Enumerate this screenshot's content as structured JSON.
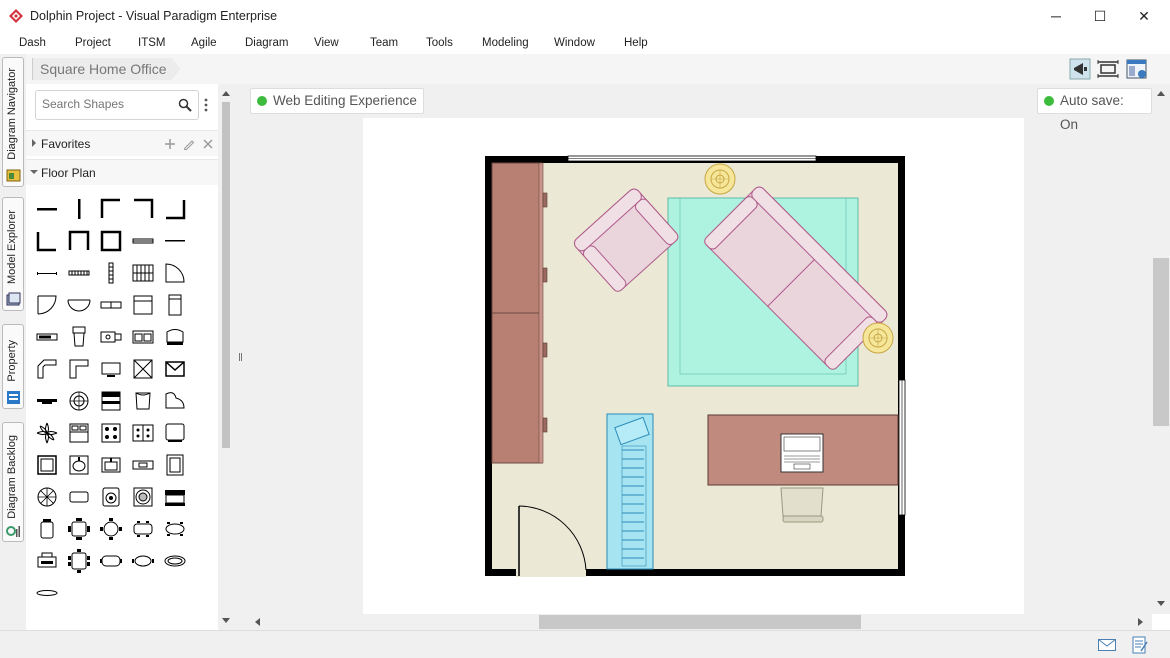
{
  "window": {
    "title": "Dolphin Project - Visual Paradigm Enterprise",
    "minimize": "─",
    "maximize": "☐",
    "close": "✕"
  },
  "menu": [
    "Dash",
    "Project",
    "ITSM",
    "Agile",
    "Diagram",
    "View",
    "Team",
    "Tools",
    "Modeling",
    "Window",
    "Help"
  ],
  "side_tabs": {
    "navigator": "Diagram Navigator",
    "explorer": "Model Explorer",
    "property": "Property",
    "backlog": "Diagram Backlog"
  },
  "breadcrumb": "Square Home Office",
  "search": {
    "placeholder": "Search Shapes"
  },
  "sections": {
    "favorites": "Favorites",
    "floor_plan": "Floor Plan"
  },
  "badges": {
    "web_editing": "Web Editing Experience",
    "autosave": "Auto save: On"
  },
  "colors": {
    "accent_green": "#3dbb3d",
    "wall": "#000000",
    "floor": "#ebe8d6",
    "rug": "#aef2e0",
    "cabinet": "#b87f73"
  }
}
